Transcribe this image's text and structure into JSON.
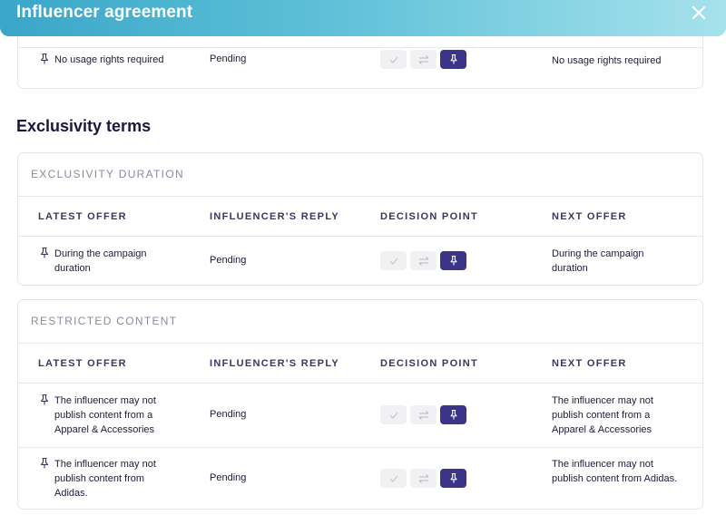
{
  "modal": {
    "title": "Influencer agreement"
  },
  "usage_rights_row": {
    "offer": "No usage rights required",
    "reply": "Pending",
    "next": "No usage rights required"
  },
  "exclusivity": {
    "title": "Exclusivity terms",
    "columns": {
      "latest": "LATEST OFFER",
      "reply": "INFLUENCER'S REPLY",
      "decision": "DECISION POINT",
      "next": "NEXT OFFER"
    },
    "duration": {
      "heading": "EXCLUSIVITY DURATION",
      "rows": [
        {
          "offer": "During the campaign duration",
          "reply": "Pending",
          "next": "During the campaign duration"
        }
      ]
    },
    "restricted": {
      "heading": "RESTRICTED CONTENT",
      "rows": [
        {
          "offer": "The influencer may not publish content from a Apparel & Accessories",
          "reply": "Pending",
          "next": "The influencer may not publish content from a Apparel & Accessories"
        },
        {
          "offer": "The influencer may not publish content from Adidas.",
          "reply": "Pending",
          "next": "The influencer may not publish content from Adidas."
        }
      ]
    }
  },
  "decision_buttons": {
    "accept_icon": "check-icon",
    "counter_icon": "swap-icon",
    "keep_icon": "pin-icon",
    "active": "keep"
  },
  "colors": {
    "header_gradient_start": "#3aa6c8",
    "header_gradient_end": "#a6e2ec",
    "active_button": "#3c3488",
    "inactive_button": "#f1f1f4"
  }
}
